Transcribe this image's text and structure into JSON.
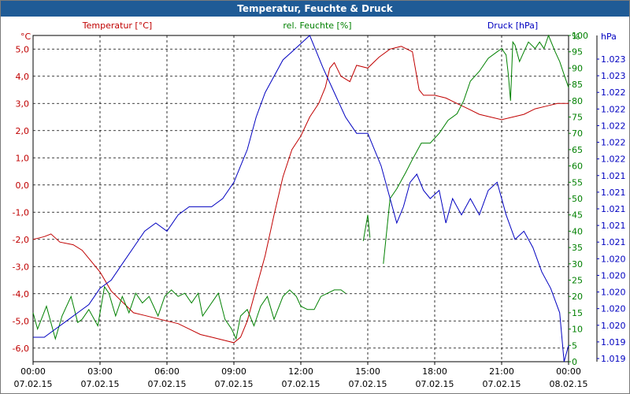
{
  "window": {
    "title": "Temperatur, Feuchte & Druck"
  },
  "colors": {
    "temperature": "#c00000",
    "humidity": "#008000",
    "pressure": "#0000c0",
    "axis": "#000000",
    "grid": "#000000",
    "title_bar": "#1f5b96"
  },
  "chart_data": {
    "type": "line",
    "title": "Temperatur, Feuchte & Druck",
    "grid": true,
    "x": {
      "unit": "hours since 07.02.15 00:00",
      "range": [
        0,
        24
      ],
      "ticks": [
        {
          "t": 0,
          "time": "00:00",
          "date": "07.02.15"
        },
        {
          "t": 3,
          "time": "03:00",
          "date": "07.02.15"
        },
        {
          "t": 6,
          "time": "06:00",
          "date": "07.02.15"
        },
        {
          "t": 9,
          "time": "09:00",
          "date": "07.02.15"
        },
        {
          "t": 12,
          "time": "12:00",
          "date": "07.02.15"
        },
        {
          "t": 15,
          "time": "15:00",
          "date": "07.02.15"
        },
        {
          "t": 18,
          "time": "18:00",
          "date": "07.02.15"
        },
        {
          "t": 21,
          "time": "21:00",
          "date": "07.02.15"
        },
        {
          "t": 24,
          "time": "00:00",
          "date": "08.02.15"
        }
      ]
    },
    "axes": {
      "temperature": {
        "unit": "°C",
        "range": [
          -6.5,
          5.5
        ],
        "ticks": [
          5,
          4,
          3,
          2,
          1,
          0,
          -1,
          -2,
          -3,
          -4,
          -5,
          -6
        ],
        "tick_labels": [
          "5,0",
          "4,0",
          "3,0",
          "2,0",
          "1,0",
          "0,0",
          "-1,0",
          "-2,0",
          "-3,0",
          "-4,0",
          "-5,0",
          "-6,0"
        ]
      },
      "humidity": {
        "unit": "%",
        "range": [
          0,
          100
        ],
        "tick_labels": [
          "100",
          "95",
          "90",
          "85",
          "80",
          "75",
          "70",
          "65",
          "60",
          "55",
          "50",
          "45",
          "40",
          "35",
          "30",
          "25",
          "20",
          "15",
          "10",
          "5",
          "0"
        ]
      },
      "pressure": {
        "unit": "hPa",
        "range": [
          1019.0,
          1023.0
        ],
        "tick_labels": [
          "1.023",
          "1.023",
          "1.022",
          "1.022",
          "1.022",
          "1.022",
          "1.022",
          "1.021",
          "1.021",
          "1.021",
          "1.021",
          "1.021",
          "1.020",
          "1.020",
          "1.020",
          "1.020",
          "1.020",
          "1.019",
          "1.019"
        ]
      }
    },
    "series": [
      {
        "name": "Temperatur [°C]",
        "axis": "temperature",
        "points": [
          [
            0,
            -2.0
          ],
          [
            0.5,
            -1.9
          ],
          [
            0.8,
            -1.8
          ],
          [
            1.2,
            -2.1
          ],
          [
            1.8,
            -2.2
          ],
          [
            2.2,
            -2.4
          ],
          [
            2.6,
            -2.8
          ],
          [
            3.0,
            -3.2
          ],
          [
            3.5,
            -3.9
          ],
          [
            4.0,
            -4.3
          ],
          [
            4.5,
            -4.7
          ],
          [
            5.0,
            -4.8
          ],
          [
            5.5,
            -4.9
          ],
          [
            6.0,
            -5.0
          ],
          [
            6.5,
            -5.1
          ],
          [
            7.0,
            -5.3
          ],
          [
            7.5,
            -5.5
          ],
          [
            8.0,
            -5.6
          ],
          [
            8.5,
            -5.7
          ],
          [
            9.0,
            -5.8
          ],
          [
            9.3,
            -5.6
          ],
          [
            9.6,
            -5.0
          ],
          [
            10.0,
            -3.8
          ],
          [
            10.4,
            -2.6
          ],
          [
            10.8,
            -1.1
          ],
          [
            11.2,
            0.3
          ],
          [
            11.6,
            1.3
          ],
          [
            12.0,
            1.8
          ],
          [
            12.4,
            2.5
          ],
          [
            12.8,
            3.0
          ],
          [
            13.1,
            3.6
          ],
          [
            13.3,
            4.3
          ],
          [
            13.5,
            4.5
          ],
          [
            13.8,
            4.0
          ],
          [
            14.2,
            3.8
          ],
          [
            14.5,
            4.4
          ],
          [
            15.0,
            4.3
          ],
          [
            15.5,
            4.7
          ],
          [
            16.0,
            5.0
          ],
          [
            16.5,
            5.1
          ],
          [
            17.0,
            4.9
          ],
          [
            17.3,
            3.5
          ],
          [
            17.5,
            3.3
          ],
          [
            18.0,
            3.3
          ],
          [
            18.5,
            3.2
          ],
          [
            19.0,
            3.0
          ],
          [
            19.5,
            2.8
          ],
          [
            20.0,
            2.6
          ],
          [
            20.5,
            2.5
          ],
          [
            21.0,
            2.4
          ],
          [
            21.5,
            2.5
          ],
          [
            22.0,
            2.6
          ],
          [
            22.5,
            2.8
          ],
          [
            23.0,
            2.9
          ],
          [
            23.5,
            3.0
          ],
          [
            24.0,
            3.0
          ]
        ]
      },
      {
        "name": "rel. Feuchte [%]",
        "axis": "humidity",
        "points": [
          [
            0,
            15
          ],
          [
            0.2,
            10
          ],
          [
            0.6,
            17
          ],
          [
            1.0,
            7
          ],
          [
            1.3,
            14
          ],
          [
            1.7,
            20
          ],
          [
            2.0,
            12
          ],
          [
            2.2,
            13
          ],
          [
            2.5,
            16
          ],
          [
            2.9,
            11
          ],
          [
            3.2,
            23
          ],
          [
            3.4,
            21
          ],
          [
            3.7,
            14
          ],
          [
            4.0,
            20
          ],
          [
            4.3,
            15
          ],
          [
            4.6,
            21
          ],
          [
            4.9,
            18
          ],
          [
            5.2,
            20
          ],
          [
            5.6,
            14
          ],
          [
            5.9,
            20
          ],
          [
            6.2,
            22
          ],
          [
            6.5,
            20
          ],
          [
            6.8,
            21
          ],
          [
            7.1,
            18
          ],
          [
            7.4,
            21
          ],
          [
            7.6,
            14
          ],
          [
            7.9,
            17
          ],
          [
            8.3,
            21
          ],
          [
            8.6,
            13
          ],
          [
            8.9,
            10
          ],
          [
            9.1,
            7
          ],
          [
            9.3,
            14
          ],
          [
            9.6,
            16
          ],
          [
            9.9,
            11
          ],
          [
            10.2,
            17
          ],
          [
            10.5,
            20
          ],
          [
            10.8,
            13
          ],
          [
            11.2,
            20
          ],
          [
            11.5,
            22
          ],
          [
            11.8,
            20
          ],
          [
            12.0,
            17
          ],
          [
            12.3,
            16
          ],
          [
            12.6,
            16
          ],
          [
            12.9,
            20
          ],
          [
            13.2,
            21
          ],
          [
            13.5,
            22
          ],
          [
            13.8,
            22
          ],
          [
            14.0,
            21
          ],
          [
            null,
            null
          ],
          [
            14.8,
            37
          ],
          [
            15.0,
            45
          ],
          [
            15.1,
            38
          ],
          [
            null,
            null
          ],
          [
            15.7,
            30
          ],
          [
            16.0,
            50
          ],
          [
            16.3,
            53
          ],
          [
            16.7,
            58
          ],
          [
            17.0,
            62
          ],
          [
            17.4,
            67
          ],
          [
            17.8,
            67
          ],
          [
            18.2,
            70
          ],
          [
            18.6,
            74
          ],
          [
            19.0,
            76
          ],
          [
            19.3,
            80
          ],
          [
            19.6,
            86
          ],
          [
            20.0,
            89
          ],
          [
            20.4,
            93
          ],
          [
            20.8,
            95
          ],
          [
            21.0,
            96
          ],
          [
            21.2,
            94
          ],
          [
            21.3,
            88
          ],
          [
            21.4,
            80
          ],
          [
            21.5,
            98
          ],
          [
            21.6,
            97
          ],
          [
            21.8,
            92
          ],
          [
            22.0,
            95
          ],
          [
            22.2,
            98
          ],
          [
            22.5,
            96
          ],
          [
            22.7,
            98
          ],
          [
            22.9,
            96
          ],
          [
            23.1,
            100
          ],
          [
            23.4,
            95
          ],
          [
            23.6,
            92
          ],
          [
            23.8,
            88
          ],
          [
            24.0,
            84
          ]
        ]
      },
      {
        "name": "Druck [hPa]",
        "axis": "pressure",
        "points": [
          [
            0,
            1019.3
          ],
          [
            0.5,
            1019.3
          ],
          [
            1.0,
            1019.4
          ],
          [
            1.5,
            1019.5
          ],
          [
            2.0,
            1019.6
          ],
          [
            2.5,
            1019.7
          ],
          [
            3.0,
            1019.9
          ],
          [
            3.5,
            1020.0
          ],
          [
            4.0,
            1020.2
          ],
          [
            4.5,
            1020.4
          ],
          [
            5.0,
            1020.6
          ],
          [
            5.5,
            1020.7
          ],
          [
            6.0,
            1020.6
          ],
          [
            6.5,
            1020.8
          ],
          [
            7.0,
            1020.9
          ],
          [
            7.5,
            1020.9
          ],
          [
            8.0,
            1020.9
          ],
          [
            8.5,
            1021.0
          ],
          [
            9.0,
            1021.2
          ],
          [
            9.3,
            1021.4
          ],
          [
            9.6,
            1021.6
          ],
          [
            10.0,
            1022.0
          ],
          [
            10.4,
            1022.3
          ],
          [
            10.8,
            1022.5
          ],
          [
            11.2,
            1022.7
          ],
          [
            11.6,
            1022.8
          ],
          [
            12.0,
            1022.9
          ],
          [
            12.4,
            1023.0
          ],
          [
            12.7,
            1022.8
          ],
          [
            13.0,
            1022.6
          ],
          [
            13.5,
            1022.3
          ],
          [
            14.0,
            1022.0
          ],
          [
            14.5,
            1021.8
          ],
          [
            15.0,
            1021.8
          ],
          [
            15.3,
            1021.6
          ],
          [
            15.6,
            1021.4
          ],
          [
            15.9,
            1021.1
          ],
          [
            16.3,
            1020.7
          ],
          [
            16.6,
            1020.9
          ],
          [
            16.9,
            1021.2
          ],
          [
            17.2,
            1021.3
          ],
          [
            17.5,
            1021.1
          ],
          [
            17.8,
            1021.0
          ],
          [
            18.2,
            1021.1
          ],
          [
            18.5,
            1020.7
          ],
          [
            18.8,
            1021.0
          ],
          [
            19.2,
            1020.8
          ],
          [
            19.6,
            1021.0
          ],
          [
            20.0,
            1020.8
          ],
          [
            20.4,
            1021.1
          ],
          [
            20.8,
            1021.2
          ],
          [
            21.2,
            1020.8
          ],
          [
            21.6,
            1020.5
          ],
          [
            22.0,
            1020.6
          ],
          [
            22.4,
            1020.4
          ],
          [
            22.8,
            1020.1
          ],
          [
            23.2,
            1019.9
          ],
          [
            23.6,
            1019.6
          ],
          [
            23.8,
            1019.0
          ],
          [
            24.0,
            1019.2
          ]
        ]
      }
    ]
  }
}
